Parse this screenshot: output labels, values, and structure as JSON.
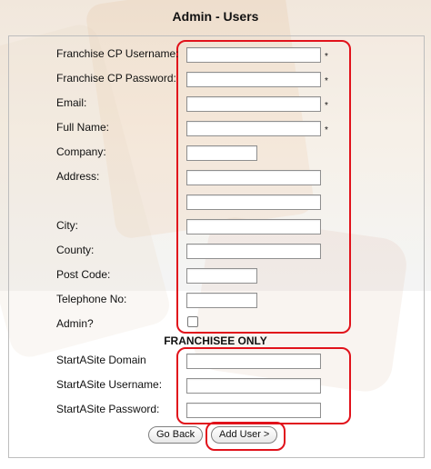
{
  "page": {
    "title": "Admin - Users"
  },
  "form": {
    "username_label": "Franchise CP Username:",
    "password_label": "Franchise CP Password:",
    "email_label": "Email:",
    "fullname_label": "Full Name:",
    "company_label": "Company:",
    "address_label": "Address:",
    "city_label": "City:",
    "county_label": "County:",
    "postcode_label": "Post Code:",
    "telephone_label": "Telephone No:",
    "admin_label": "Admin?",
    "required_marker": "*",
    "franchisee_heading": "FRANCHISEE ONLY",
    "startasite_domain_label": "StartASite Domain",
    "startasite_username_label": "StartASite Username:",
    "startasite_password_label": "StartASite Password:",
    "go_back_label": "Go Back",
    "add_user_label": "Add User >"
  },
  "colors": {
    "highlight": "#e1121b"
  }
}
